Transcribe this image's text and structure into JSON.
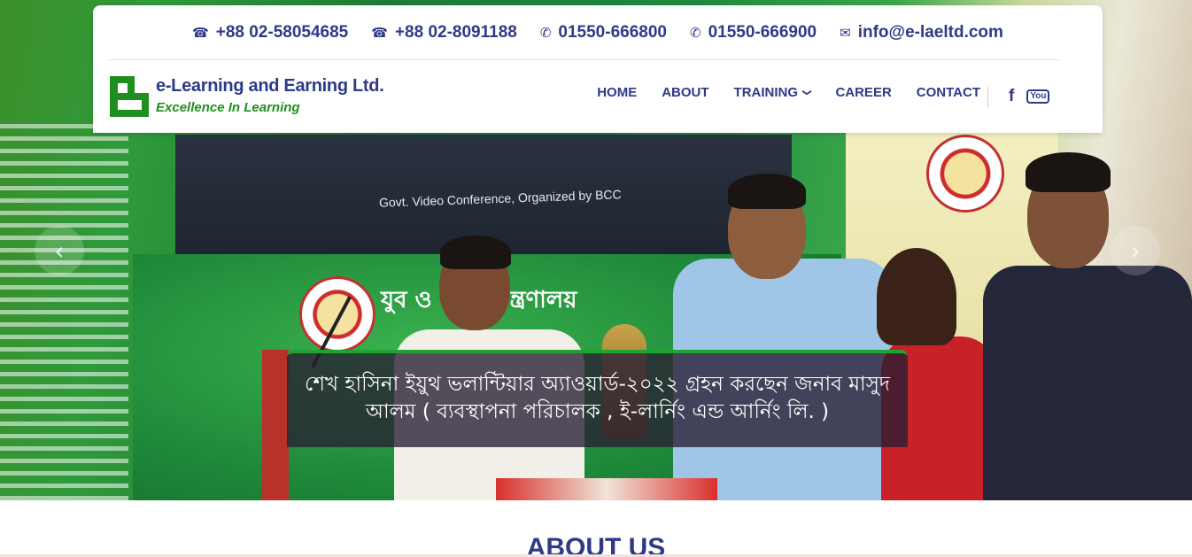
{
  "header": {
    "contacts": [
      {
        "icon": "phone-icon",
        "glyph": "☎",
        "label": "+88 02-58054685"
      },
      {
        "icon": "phone-icon",
        "glyph": "☎",
        "label": "+88 02-8091188"
      },
      {
        "icon": "mobile-phone-icon",
        "glyph": "✆",
        "label": "01550-666800"
      },
      {
        "icon": "mobile-phone-icon",
        "glyph": "✆",
        "label": "01550-666900"
      },
      {
        "icon": "envelope-icon",
        "glyph": "✉",
        "label": "info@e-laeltd.com"
      }
    ],
    "logo": {
      "name": "e-Learning and Earning Ltd.",
      "tagline": "Excellence In Learning"
    },
    "nav": [
      {
        "label": "HOME"
      },
      {
        "label": "ABOUT"
      },
      {
        "label": "TRAINING",
        "has_dropdown": true
      },
      {
        "label": "CAREER"
      },
      {
        "label": "CONTACT"
      }
    ],
    "social": {
      "facebook": "f",
      "youtube": "You"
    }
  },
  "slider": {
    "board_text": "Govt. Video Conference, Organized by BCC",
    "wall_text": "যুব ও ক্রীড়া মন্ত্রণালয়",
    "caption": "শেখ হাসিনা ইয়ুথ ভলান্টিয়ার অ্যাওয়ার্ড-২০২২ গ্রহন করছেন জনাব মাসুদ আলম ( ব্যবস্থাপনা পরিচালক , ই-লার্নিং এন্ড আর্নিং লি. )",
    "prev_arrow": "‹",
    "next_arrow": "›"
  },
  "about": {
    "heading": "ABOUT US"
  },
  "colors": {
    "brand_blue": "#2e3a87",
    "brand_green": "#1e8f1e",
    "caption_accent": "#1fa52f"
  }
}
